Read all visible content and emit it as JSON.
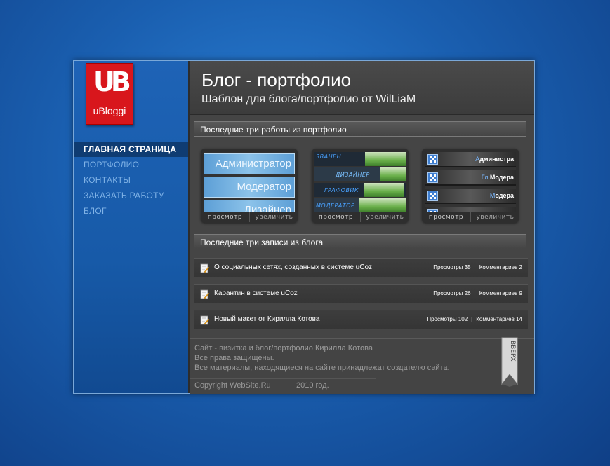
{
  "logo": {
    "mark": "UB",
    "name": "uBloggi"
  },
  "nav": {
    "items": [
      {
        "label": "ГЛАВНАЯ СТРАНИЦА",
        "active": true
      },
      {
        "label": "ПОРТФОЛИО",
        "active": false
      },
      {
        "label": "КОНТАКТЫ",
        "active": false
      },
      {
        "label": "ЗАКАЗАТЬ РАБОТУ",
        "active": false
      },
      {
        "label": "БЛОГ",
        "active": false
      }
    ]
  },
  "header": {
    "title": "Блог - портфолио",
    "subtitle": "Шаблон для блога/портфолио от WilLiaM"
  },
  "portfolio": {
    "heading": "Последние три работы из портфолио",
    "items": [
      {
        "view_label": "просмотр",
        "zoom_label": "увеличить",
        "preview_rows": [
          "Администратор",
          "Модератор",
          "Дизайнер"
        ]
      },
      {
        "view_label": "просмотр",
        "zoom_label": "увеличить",
        "preview_rows": [
          "ЗВАНЕН",
          "ДИЗАЙНЕР",
          "ГРАФОВИК",
          "МОДЕРАТОР"
        ]
      },
      {
        "view_label": "просмотр",
        "zoom_label": "увеличить",
        "preview_rows": [
          {
            "pre": "А",
            "rest": "дминистра"
          },
          {
            "pre": "Гл.",
            "rest": "Модера"
          },
          {
            "pre": "М",
            "rest": "одера"
          }
        ]
      }
    ]
  },
  "blog": {
    "heading": "Последние три записи из блога",
    "posts": [
      {
        "title": "О социальных сетях, созданных в системе uCoz",
        "views": "Просмотры 35",
        "comments": "Комментариев 2"
      },
      {
        "title": "Карантин в системе uCoz",
        "views": "Просмотры 26",
        "comments": "Комментариев 9"
      },
      {
        "title": "Новый макет от Кирилла Котова",
        "views": "Просмотры 102",
        "comments": "Комментариев 14"
      }
    ]
  },
  "footer": {
    "line1": "Сайт - визитка и блог/портфолио Кирилла Котова",
    "line2": "Все права защищены.",
    "line3": "Все материалы, находящиеся на сайте принадлежат создателю сайта.",
    "copyright": "Copyright WebSite.Ru",
    "year": "2010 год.",
    "top_label": "ВВЕРХ"
  },
  "colors": {
    "desktop": "#1a5fb0",
    "sidebar": "#175aa8",
    "nav_active_bg": "#0f3c72",
    "logo_red": "#d8161c",
    "panel": "#454545"
  }
}
